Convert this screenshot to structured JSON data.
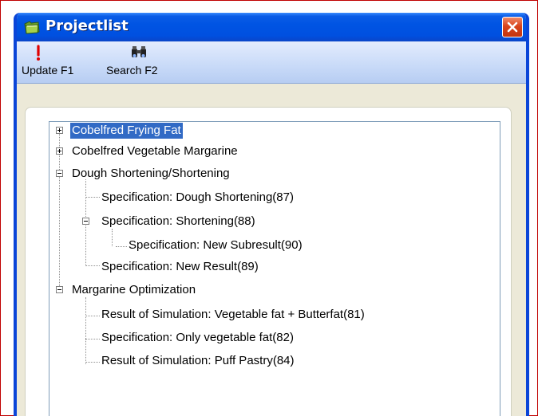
{
  "window": {
    "title": "Projectlist"
  },
  "toolbar": {
    "update_label": "Update F1",
    "search_label": "Search F2"
  },
  "tree": {
    "nodes": [
      {
        "label": "Cobelfred Frying Fat",
        "state": "collapsed",
        "selected": true
      },
      {
        "label": "Cobelfred Vegetable Margarine",
        "state": "collapsed"
      },
      {
        "label": "Dough Shortening/Shortening",
        "state": "expanded",
        "children": [
          {
            "label": "Specification: Dough Shortening(87)"
          },
          {
            "label": "Specification: Shortening(88)",
            "state": "expanded",
            "children": [
              {
                "label": "Specification: New Subresult(90)"
              }
            ]
          },
          {
            "label": "Specification: New Result(89)"
          }
        ]
      },
      {
        "label": "Margarine Optimization",
        "state": "expanded",
        "children": [
          {
            "label": "Result of Simulation: Vegetable fat + Butterfat(81)"
          },
          {
            "label": "Specification: Only vegetable fat(82)"
          },
          {
            "label": "Result of Simulation: Puff Pastry(84)"
          }
        ]
      }
    ]
  },
  "colors": {
    "title_bar": "#0054e3",
    "selection": "#316ac5",
    "close_button": "#d8441c",
    "frame_border": "#c00000"
  },
  "icons": {
    "app": "folder-icon",
    "close": "close-icon",
    "update": "exclamation-icon",
    "search": "binoculars-icon"
  }
}
